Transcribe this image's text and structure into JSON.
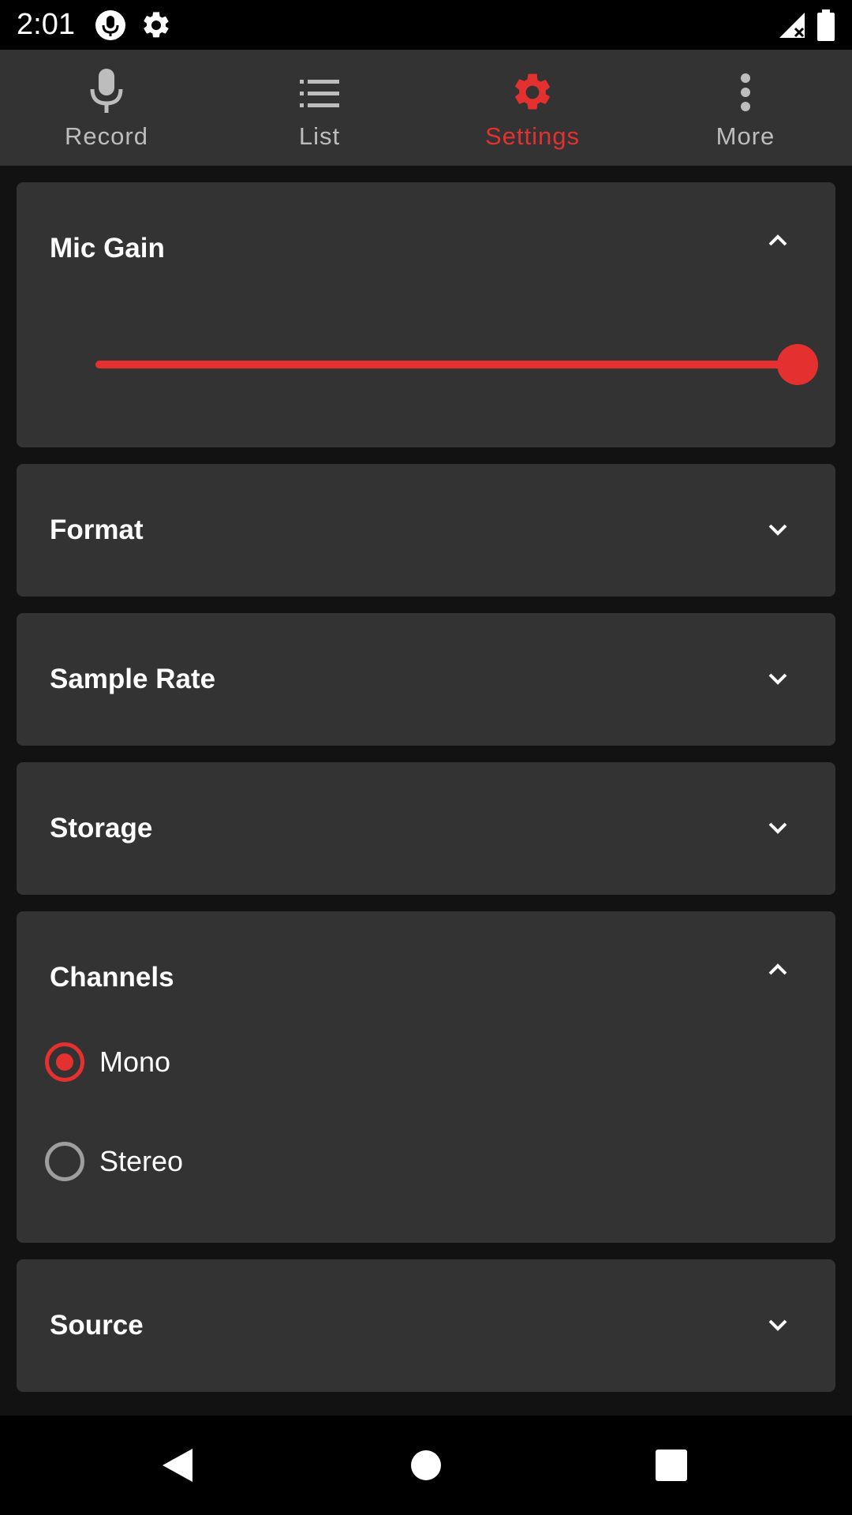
{
  "status_bar": {
    "time": "2:01",
    "icons": [
      "mic-icon",
      "gear-icon",
      "signal-icon",
      "battery-icon"
    ]
  },
  "tabs": [
    {
      "label": "Record",
      "icon": "mic-icon",
      "active": false
    },
    {
      "label": "List",
      "icon": "list-icon",
      "active": false
    },
    {
      "label": "Settings",
      "icon": "gear-icon",
      "active": true
    },
    {
      "label": "More",
      "icon": "more-vert-icon",
      "active": false
    }
  ],
  "colors": {
    "accent": "#e53030",
    "card": "#333333",
    "background": "#121212",
    "inactive_text": "#bdbdbd"
  },
  "sections": {
    "mic_gain": {
      "title": "Mic Gain",
      "expanded": true,
      "value_fraction": 1.0
    },
    "format": {
      "title": "Format",
      "expanded": false
    },
    "sample_rate": {
      "title": "Sample Rate",
      "expanded": false
    },
    "storage": {
      "title": "Storage",
      "expanded": false
    },
    "channels": {
      "title": "Channels",
      "expanded": true,
      "options": [
        {
          "label": "Mono",
          "checked": true
        },
        {
          "label": "Stereo",
          "checked": false
        }
      ]
    },
    "source": {
      "title": "Source",
      "expanded": false
    }
  },
  "nav_bar": {
    "buttons": [
      "back-icon",
      "home-icon",
      "recents-icon"
    ]
  }
}
